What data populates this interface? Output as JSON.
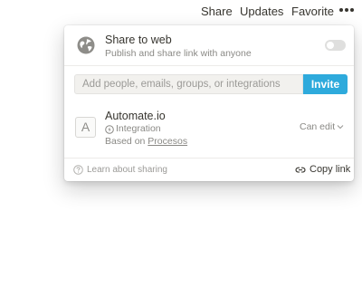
{
  "topbar": {
    "share": "Share",
    "updates": "Updates",
    "favorite": "Favorite",
    "more_icon": "ellipsis-icon"
  },
  "share_to_web": {
    "icon": "globe-icon",
    "title": "Share to web",
    "subtitle": "Publish and share link with anyone",
    "enabled": false
  },
  "invite": {
    "placeholder": "Add people, emails, groups, or integrations",
    "value": "",
    "button_label": "Invite",
    "button_color": "#2eaadc"
  },
  "member": {
    "avatar_letter": "A",
    "name": "Automate.io",
    "type_icon": "integration-icon",
    "type": "Integration",
    "based_on_prefix": "Based on",
    "based_on_link": "Procesos",
    "role": "Can edit"
  },
  "footer": {
    "help_icon": "help-circle-icon",
    "learn_label": "Learn about sharing",
    "copy_icon": "link-icon",
    "copy_label": "Copy link"
  }
}
